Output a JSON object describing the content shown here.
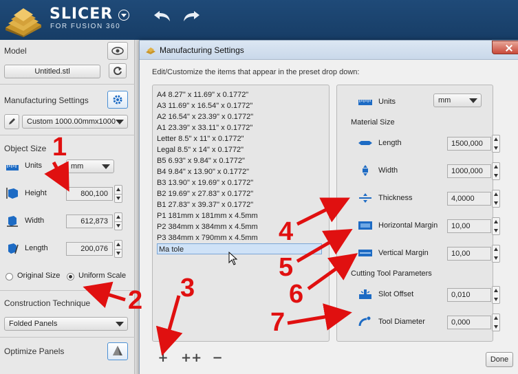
{
  "app": {
    "name": "SLICER",
    "subtitle": "FOR FUSION 360",
    "colors": {
      "topbar": "#1f4a78",
      "accent": "#4a8fd4",
      "annotation": "#e01010"
    }
  },
  "sidebar": {
    "model": {
      "title": "Model",
      "file_label": "Untitled.stl"
    },
    "manufacturing": {
      "title": "Manufacturing Settings",
      "preset_label": "Custom 1000.00mmx1000"
    },
    "object_size": {
      "title": "Object Size",
      "units_label": "Units",
      "units_value": "mm",
      "rows": [
        {
          "label": "Height",
          "value": "800,100"
        },
        {
          "label": "Width",
          "value": "612,873"
        },
        {
          "label": "Length",
          "value": "200,076"
        }
      ],
      "radio_original": "Original Size",
      "radio_uniform": "Uniform Scale"
    },
    "construction": {
      "title": "Construction Technique",
      "value": "Folded Panels"
    },
    "optimize": {
      "title": "Optimize Panels"
    }
  },
  "dialog": {
    "title": "Manufacturing Settings",
    "description": "Edit/Customize the items that appear in the preset drop down:",
    "presets": [
      "A4 8.27\" x 11.69\" x 0.1772\"",
      "A3 11.69\" x 16.54\" x 0.1772\"",
      "A2 16.54\" x 23.39\" x 0.1772\"",
      "A1 23.39\" x 33.11\" x 0.1772\"",
      "Letter 8.5\" x 11\" x 0.1772\"",
      "Legal 8.5\" x 14\" x 0.1772\"",
      "B5 6.93\" x 9.84\" x 0.1772\"",
      "B4 9.84\" x 13.90\" x 0.1772\"",
      "B3 13.90\" x 19.69\" x 0.1772\"",
      "B2 19.69\" x 27.83\" x 0.1772\"",
      "B1 27.83\" x 39.37\" x 0.1772\"",
      "P1 181mm x 181mm x 4.5mm",
      "P2 384mm x 384mm x 4.5mm",
      "P3 384mm x 790mm x 4.5mm",
      "Ma tole"
    ],
    "selected_preset": "Ma tole",
    "props": {
      "units_label": "Units",
      "units_value": "mm",
      "material_size_title": "Material Size",
      "length_label": "Length",
      "length_value": "1500,000",
      "width_label": "Width",
      "width_value": "1000,000",
      "thickness_label": "Thickness",
      "thickness_value": "4,0000",
      "hmargin_label": "Horizontal Margin",
      "hmargin_value": "10,00",
      "vmargin_label": "Vertical Margin",
      "vmargin_value": "10,00",
      "cutting_title": "Cutting Tool Parameters",
      "slot_label": "Slot Offset",
      "slot_value": "0,010",
      "tool_label": "Tool Diameter",
      "tool_value": "0,000"
    },
    "add_label": "+",
    "duplicate_label": "++",
    "remove_label": "−",
    "done_label": "Done"
  },
  "annotations": {
    "n1": "1",
    "n2": "2",
    "n3": "3",
    "n4": "4",
    "n5": "5",
    "n6": "6",
    "n7": "7"
  }
}
